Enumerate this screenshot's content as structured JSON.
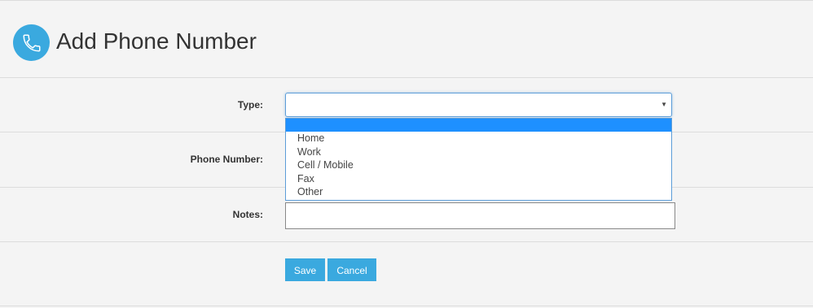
{
  "header": {
    "title": "Add Phone Number",
    "icon": "phone-icon",
    "icon_color": "#3aa9df"
  },
  "form": {
    "type_label": "Type:",
    "type_value": "",
    "type_options": [
      "",
      "Home",
      "Work",
      "Cell / Mobile",
      "Fax",
      "Other"
    ],
    "phone_label": "Phone Number:",
    "notes_label": "Notes:",
    "notes_value": ""
  },
  "buttons": {
    "save": "Save",
    "cancel": "Cancel"
  },
  "colors": {
    "accent": "#3aa9df",
    "dropdown_highlight": "#1e90ff",
    "background": "#f4f4f4"
  }
}
